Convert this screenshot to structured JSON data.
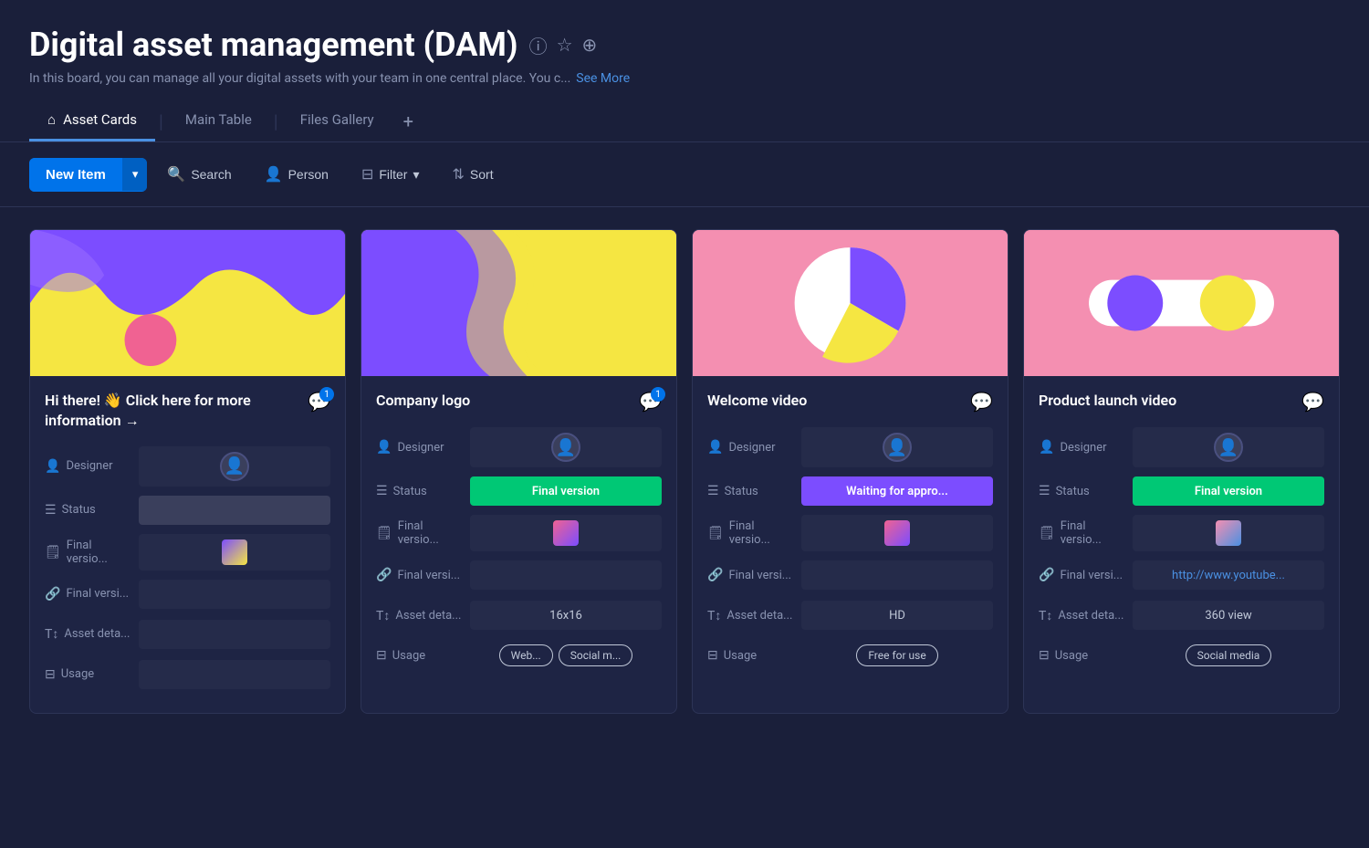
{
  "page": {
    "title": "Digital asset management (DAM)",
    "subtitle": "In this board, you can manage all your digital assets with your team in one central place. You c...",
    "see_more": "See More"
  },
  "tabs": [
    {
      "label": "Asset Cards",
      "active": true,
      "icon": "🏠"
    },
    {
      "label": "Main Table",
      "active": false
    },
    {
      "label": "Files Gallery",
      "active": false
    }
  ],
  "toolbar": {
    "new_item": "New Item",
    "search": "Search",
    "person": "Person",
    "filter": "Filter",
    "sort": "Sort"
  },
  "cards": [
    {
      "id": "card-1",
      "title": "Hi there! 👋 Click here for more information →",
      "has_comment_badge": true,
      "comment_count": "1",
      "thumbnail_type": "wave-purple",
      "fields": {
        "designer_label": "Designer",
        "status_label": "Status",
        "status_value": "",
        "status_type": "empty",
        "final_version_label": "Final versio...",
        "final_versi_label": "Final versi...",
        "asset_deta_label": "Asset deta...",
        "asset_deta_value": "",
        "usage_label": "Usage",
        "usage_tags": []
      }
    },
    {
      "id": "card-2",
      "title": "Company logo",
      "has_comment_badge": true,
      "comment_count": "1",
      "thumbnail_type": "wave-pink",
      "fields": {
        "designer_label": "Designer",
        "status_label": "Status",
        "status_value": "Final version",
        "status_type": "green",
        "final_version_label": "Final versio...",
        "final_versi_label": "Final versi...",
        "asset_deta_label": "Asset deta...",
        "asset_deta_value": "16x16",
        "usage_label": "Usage",
        "usage_tags": [
          "Web...",
          "Social m..."
        ]
      }
    },
    {
      "id": "card-3",
      "title": "Welcome video",
      "has_comment_badge": false,
      "comment_count": "",
      "thumbnail_type": "pie-chart",
      "fields": {
        "designer_label": "Designer",
        "status_label": "Status",
        "status_value": "Waiting for appro...",
        "status_type": "purple",
        "final_version_label": "Final versio...",
        "final_versi_label": "Final versi...",
        "asset_deta_label": "Asset deta...",
        "asset_deta_value": "HD",
        "usage_label": "Usage",
        "usage_tags": [
          "Free for use"
        ]
      }
    },
    {
      "id": "card-4",
      "title": "Product launch video",
      "has_comment_badge": false,
      "comment_count": "",
      "thumbnail_type": "toggle",
      "fields": {
        "designer_label": "Designer",
        "status_label": "Status",
        "status_value": "Final version",
        "status_type": "green",
        "final_version_label": "Final versio...",
        "final_versi_label": "Final versi...",
        "asset_deta_label": "Asset deta...",
        "asset_deta_value": "360 view",
        "usage_label": "Usage",
        "usage_tags": [
          "Social media"
        ],
        "link_value": "http://www.youtube..."
      }
    }
  ]
}
